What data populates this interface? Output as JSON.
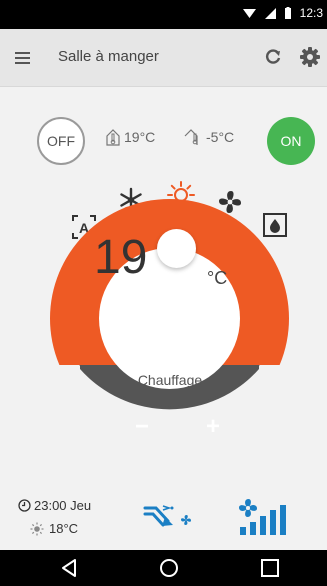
{
  "status_bar": {
    "time": "12:3"
  },
  "toolbar": {
    "title": "Salle à manger"
  },
  "power": {
    "off_label": "OFF",
    "on_label": "ON"
  },
  "temps": {
    "indoor": "19°C",
    "outdoor": "-5°C"
  },
  "setpoint": {
    "value": "19",
    "unit": "°C",
    "mode_label": "Chauffage"
  },
  "controls": {
    "minus_label": "−",
    "plus_label": "+"
  },
  "schedule": {
    "time": "23:00 Jeu",
    "temp": "18°C"
  },
  "colors": {
    "heat": "#ee5a24",
    "dark": "#555555",
    "accent_blue": "#1b7fc4",
    "on_green": "#47b653"
  }
}
